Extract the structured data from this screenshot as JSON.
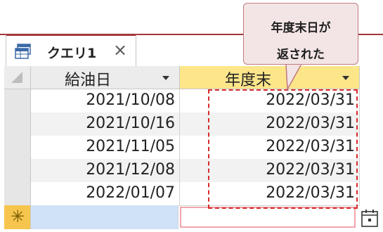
{
  "tab": {
    "label": "クエリ1",
    "close_glyph": "×"
  },
  "columns": [
    {
      "label": "給油日"
    },
    {
      "label": "年度末"
    }
  ],
  "rows": [
    {
      "kyuyubi": "2021/10/08",
      "nendomatsu": "2022/03/31"
    },
    {
      "kyuyubi": "2021/10/16",
      "nendomatsu": "2022/03/31"
    },
    {
      "kyuyubi": "2021/11/05",
      "nendomatsu": "2022/03/31"
    },
    {
      "kyuyubi": "2021/12/08",
      "nendomatsu": "2022/03/31"
    },
    {
      "kyuyubi": "2022/01/07",
      "nendomatsu": "2022/03/31"
    }
  ],
  "new_record": {
    "glyph": "✳"
  },
  "callout": {
    "line1": "年度末日が",
    "line2": "返された"
  },
  "icons": {
    "tab": "query-icon",
    "date_picker": "calendar-icon"
  },
  "colors": {
    "accent": "#a4373a",
    "active_header": "#fde58a",
    "new_row": "#f6c54d",
    "highlight": "#d62a2a"
  }
}
